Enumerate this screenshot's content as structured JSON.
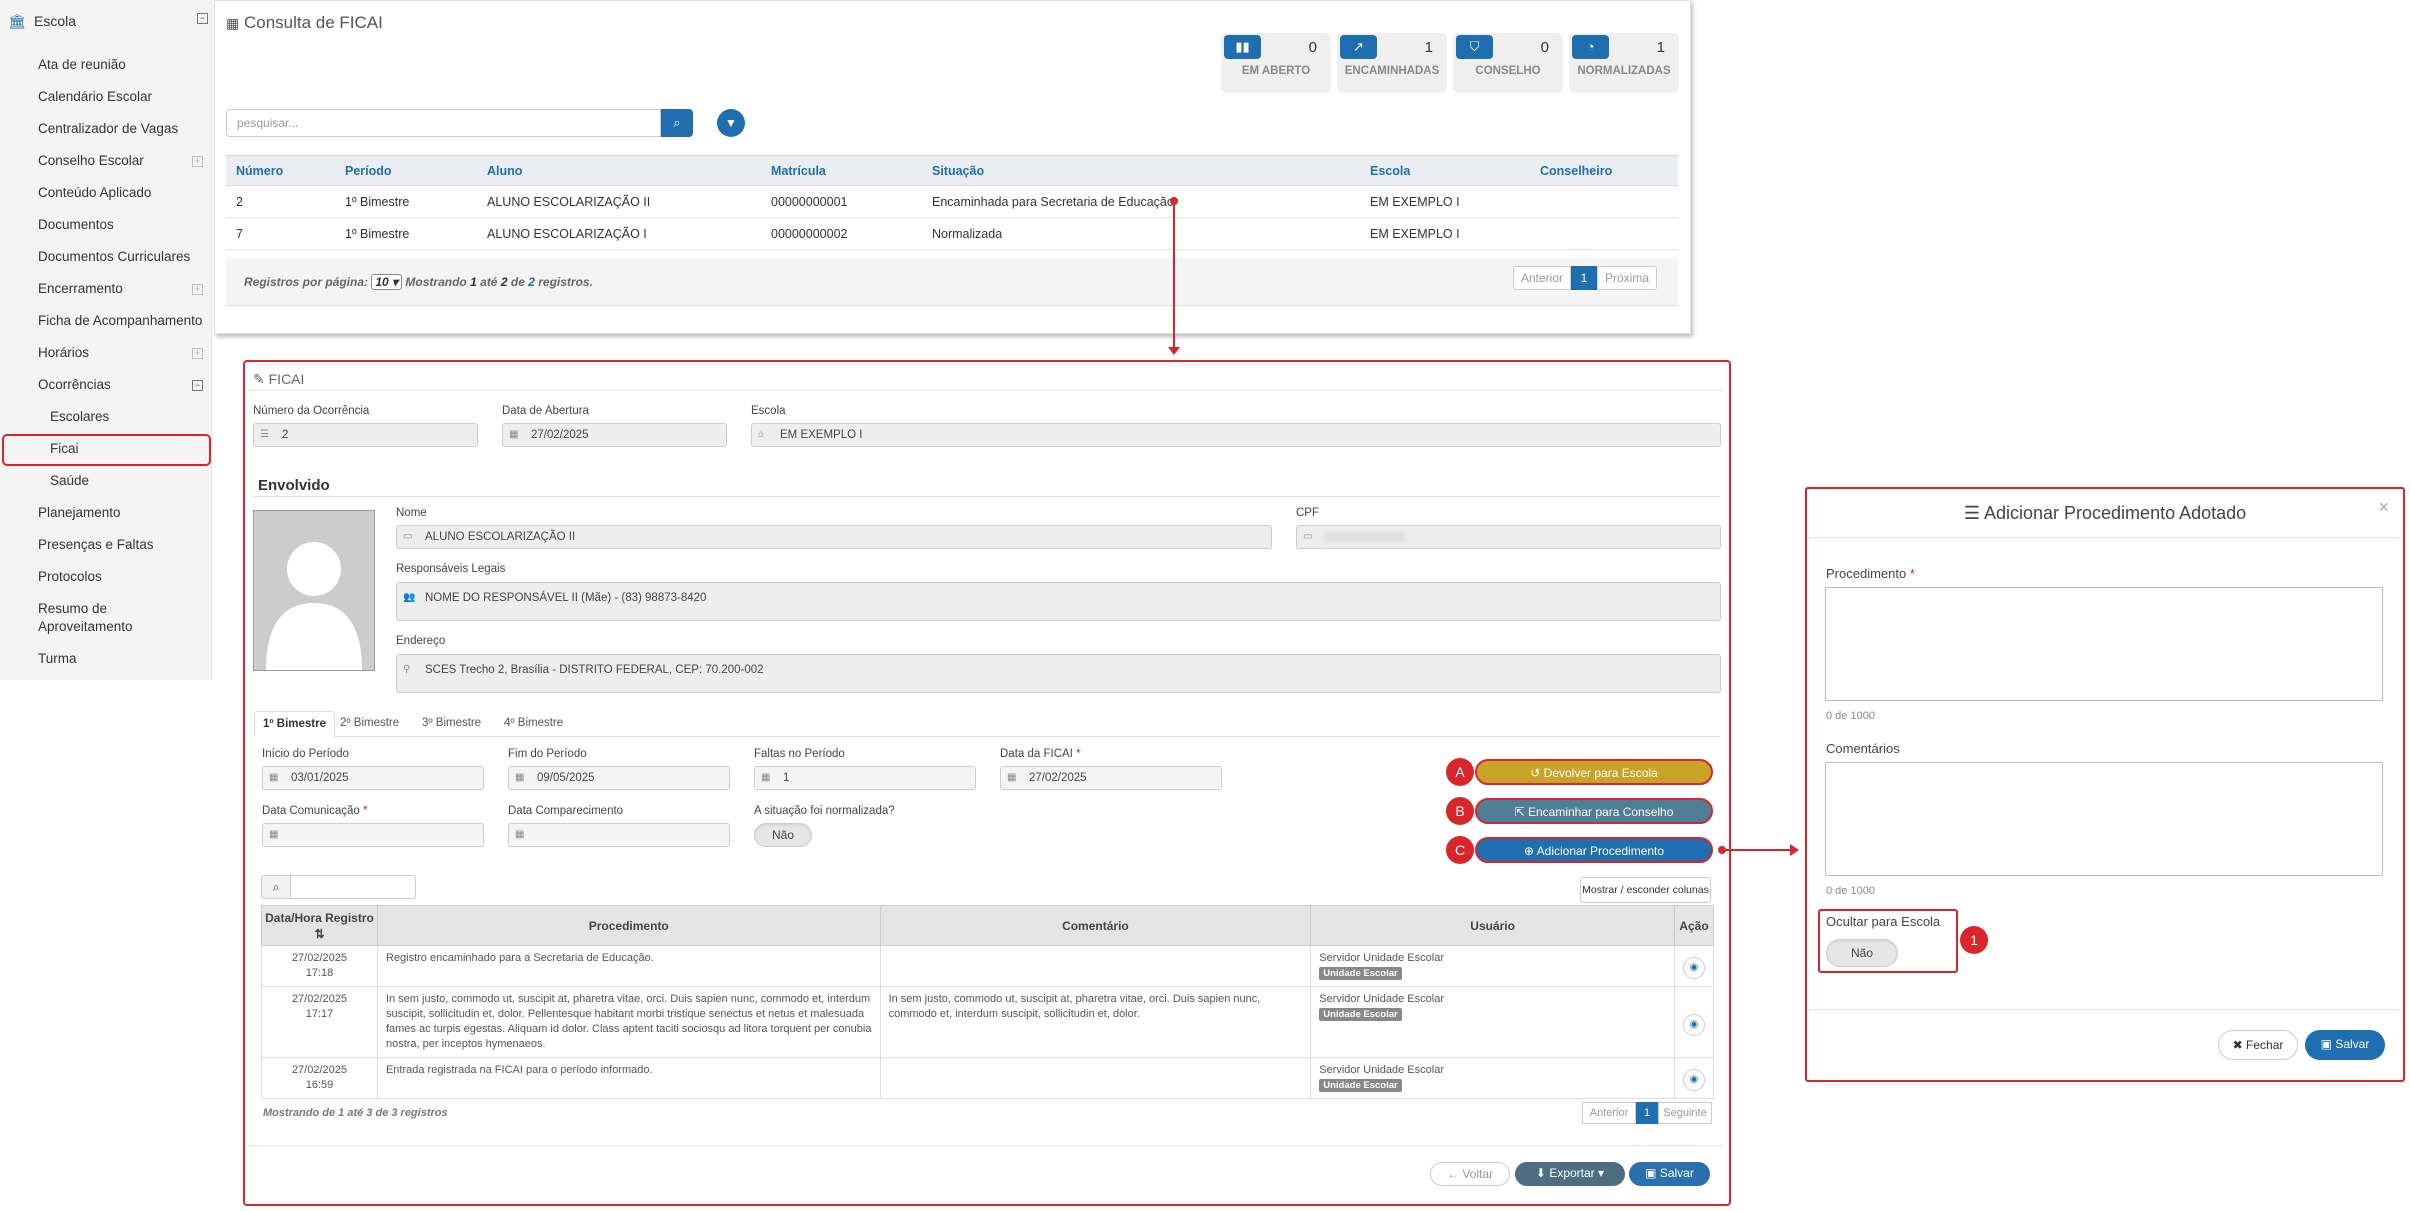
{
  "sidebar": {
    "header": "Escola",
    "items": [
      {
        "label": "Ata de reunião"
      },
      {
        "label": "Calendário Escolar"
      },
      {
        "label": "Centralizador de Vagas"
      },
      {
        "label": "Conselho Escolar"
      },
      {
        "label": "Conteúdo Aplicado"
      },
      {
        "label": "Documentos"
      },
      {
        "label": "Documentos Curriculares"
      },
      {
        "label": "Encerramento"
      },
      {
        "label": "Ficha de Acompanhamento"
      },
      {
        "label": "Horários"
      },
      {
        "label": "Ocorrências"
      },
      {
        "label": "Escolares"
      },
      {
        "label": "Ficai"
      },
      {
        "label": "Saúde"
      },
      {
        "label": "Planejamento"
      },
      {
        "label": "Presenças e Faltas"
      },
      {
        "label": "Protocolos"
      },
      {
        "label": "Resumo de Aproveitamento"
      },
      {
        "label": "Turma"
      }
    ]
  },
  "consulta": {
    "title": "Consulta de FICAI",
    "stats": [
      {
        "value": "0",
        "label": "EM ABERTO",
        "icon": "bar-chart-icon"
      },
      {
        "value": "1",
        "label": "ENCAMINHADAS",
        "icon": "line-chart-icon"
      },
      {
        "value": "0",
        "label": "CONSELHO",
        "icon": "shield-icon"
      },
      {
        "value": "1",
        "label": "NORMALIZADAS",
        "icon": "clock-icon"
      }
    ],
    "search_placeholder": "pesquisar...",
    "columns": [
      "Número",
      "Período",
      "Aluno",
      "Matrícula",
      "Situação",
      "Escola",
      "Conselheiro"
    ],
    "rows": [
      [
        "2",
        "1º Bimestre",
        "ALUNO ESCOLARIZAÇÃO II",
        "00000000001",
        "Encaminhada para Secretaria de Educação",
        "EM EXEMPLO I",
        ""
      ],
      [
        "7",
        "1º Bimestre",
        "ALUNO ESCOLARIZAÇÃO I",
        "00000000002",
        "Normalizada",
        "EM EXEMPLO I",
        ""
      ]
    ],
    "footer": {
      "per_page_label": "Registros por página:",
      "per_page_value": "10",
      "showing_pre": "Mostrando",
      "from": "1",
      "to_word": "até",
      "to": "2",
      "of_word": "de",
      "total": "2",
      "records_word": "registros."
    },
    "pagination": {
      "prev": "Anterior",
      "current": "1",
      "next": "Próxima"
    }
  },
  "ficai": {
    "title": "FICAI",
    "numero_label": "Número da Ocorrência",
    "numero_value": "2",
    "abertura_label": "Data de Abertura",
    "abertura_value": "27/02/2025",
    "escola_label": "Escola",
    "escola_value": "EM EXEMPLO I",
    "envolvido_title": "Envolvido",
    "nome_label": "Nome",
    "nome_value": "ALUNO ESCOLARIZAÇÃO II",
    "cpf_label": "CPF",
    "responsaveis_label": "Responsáveis Legais",
    "responsaveis_value": "NOME DO RESPONSÁVEL II (Mãe) - (83) 98873-8420",
    "endereco_label": "Endereço",
    "endereco_value": "SCES Trecho 2, Brasília - DISTRITO FEDERAL, CEP: 70.200-002",
    "tabs": [
      "1º Bimestre",
      "2º Bimestre",
      "3º Bimestre",
      "4º Bimestre"
    ],
    "inicio_label": "Início do Período",
    "inicio_value": "03/01/2025",
    "fim_label": "Fim do Período",
    "fim_value": "09/05/2025",
    "faltas_label": "Faltas no Período",
    "faltas_value": "1",
    "data_ficai_label": "Data da FICAI",
    "data_ficai_value": "27/02/2025",
    "comunicacao_label": "Data Comunicação",
    "comparecimento_label": "Data Comparecimento",
    "normalizada_label": "A situação foi normalizada?",
    "normalizada_value": "Não",
    "actions": [
      {
        "marker": "A",
        "label": "Devolver para Escola",
        "color": "#c9a227"
      },
      {
        "marker": "B",
        "label": "Encaminhar para Conselho",
        "color": "#4f7f96"
      },
      {
        "marker": "C",
        "label": "Adicionar Procedimento",
        "color": "#1f6fb0"
      }
    ],
    "columns_toggle": "Mostrar / esconder colunas",
    "table_columns": [
      "Data/Hora Registro",
      "Procedimento",
      "Comentário",
      "Usuário",
      "Ação"
    ],
    "records": [
      {
        "date": "27/02/2025",
        "time": "17:18",
        "procedimento": "Registro encaminhado para a Secretaria de Educação.",
        "comentario": "",
        "usuario": "Servidor Unidade Escolar",
        "badge": "Unidade Escolar"
      },
      {
        "date": "27/02/2025",
        "time": "17:17",
        "procedimento": "In sem justo, commodo ut, suscipit at, pharetra vitae, orci. Duis sapien nunc, commodo et, interdum suscipit, sollicitudin et, dolor. Pellentesque habitant morbi tristique senectus et netus et malesuada fames ac turpis egestas. Aliquam id dolor. Class aptent taciti sociosqu ad litora torquent per conubia nostra, per inceptos hymenaeos.",
        "comentario": "In sem justo, commodo ut, suscipit at, pharetra vitae, orci. Duis sapien nunc, commodo et, interdum suscipit, sollicitudin et, dolor.",
        "usuario": "Servidor Unidade Escolar",
        "badge": "Unidade Escolar"
      },
      {
        "date": "27/02/2025",
        "time": "16:59",
        "procedimento": "Entrada registrada na FICAI para o período informado.",
        "comentario": "",
        "usuario": "Servidor Unidade Escolar",
        "badge": "Unidade Escolar"
      }
    ],
    "records_footer": "Mostrando de 1 até 3 de 3 registros",
    "pagination": {
      "prev": "Anterior",
      "current": "1",
      "next": "Seguinte"
    },
    "voltar": "Voltar",
    "exportar": "Exportar",
    "salvar": "Salvar"
  },
  "modal": {
    "title": "Adicionar Procedimento Adotado",
    "close": "×",
    "procedimento_label": "Procedimento",
    "procedimento_count": "0 de 1000",
    "comentarios_label": "Comentários",
    "comentarios_count": "0 de 1000",
    "ocultar_label": "Ocultar para Escola",
    "ocultar_value": "Não",
    "marker": "1",
    "fechar": "Fechar",
    "salvar": "Salvar"
  },
  "colors": {
    "primary": "#1f6fb0",
    "highlight": "#d9252b"
  }
}
